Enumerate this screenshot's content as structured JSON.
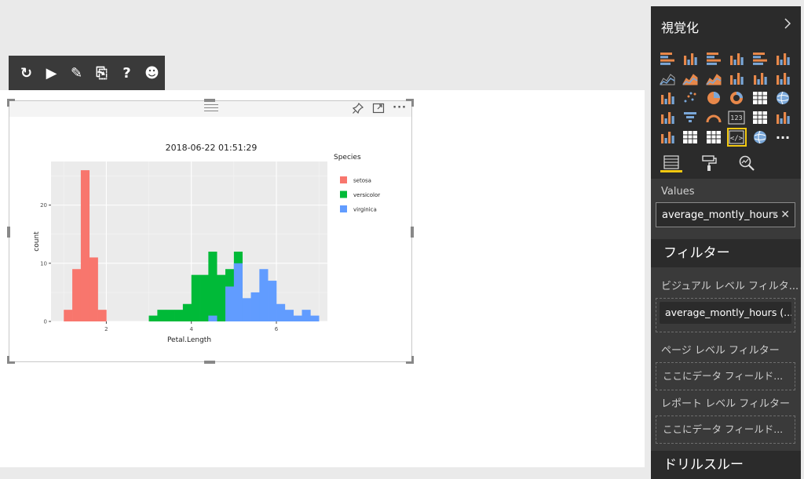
{
  "toolbar": {
    "items": [
      {
        "name": "refresh-icon",
        "glyph": "↻"
      },
      {
        "name": "run-icon",
        "glyph": "▶"
      },
      {
        "name": "edit-script-icon",
        "glyph": "✎"
      },
      {
        "name": "export-icon",
        "glyph": "⎘"
      },
      {
        "name": "help-icon",
        "glyph": "?"
      },
      {
        "name": "feedback-smile-icon",
        "glyph": "☻"
      }
    ]
  },
  "visual_header": {
    "pin_icon": "pin-icon",
    "focus_icon": "focus-mode-icon",
    "more_label": "···"
  },
  "colors": {
    "setosa": "#F8766D",
    "versicolor": "#00BA38",
    "virginica": "#619CFF",
    "accent": "#f2c811"
  },
  "chart_data": {
    "type": "bar",
    "title": "2018-06-22 01:51:29",
    "xlabel": "Petal.Length",
    "ylabel": "count",
    "legend_title": "Species",
    "legend_position": "right",
    "grid": true,
    "xlim": [
      0.7,
      7.2
    ],
    "ylim": [
      0,
      27.5
    ],
    "x_ticks": [
      "2",
      "4",
      "6"
    ],
    "x_tick_values": [
      2,
      4,
      6
    ],
    "y_ticks": [
      "0",
      "10",
      "20"
    ],
    "y_tick_values": [
      0,
      10,
      20
    ],
    "bin_width": 0.2,
    "series": [
      {
        "name": "setosa",
        "bins": [
          [
            1.0,
            2
          ],
          [
            1.2,
            9
          ],
          [
            1.4,
            26
          ],
          [
            1.6,
            11
          ],
          [
            1.8,
            2
          ]
        ]
      },
      {
        "name": "versicolor",
        "bins": [
          [
            3.0,
            1
          ],
          [
            3.2,
            2
          ],
          [
            3.4,
            2
          ],
          [
            3.6,
            2
          ],
          [
            3.8,
            3
          ],
          [
            4.0,
            8
          ],
          [
            4.2,
            8
          ],
          [
            4.4,
            12
          ],
          [
            4.6,
            8
          ],
          [
            4.8,
            9
          ],
          [
            5.0,
            12
          ]
        ]
      },
      {
        "name": "virginica",
        "bins": [
          [
            4.4,
            1
          ],
          [
            4.8,
            6
          ],
          [
            5.0,
            10
          ],
          [
            5.2,
            4
          ],
          [
            5.4,
            5
          ],
          [
            5.6,
            9
          ],
          [
            5.8,
            7
          ],
          [
            6.0,
            3
          ],
          [
            6.2,
            2
          ],
          [
            6.4,
            1
          ],
          [
            6.6,
            2
          ],
          [
            6.8,
            1
          ]
        ]
      }
    ]
  },
  "pane": {
    "title": "視覚化",
    "values_label": "Values",
    "values_field": "average_montly_hours",
    "filters_header": "フィルター",
    "visual_level_label": "ビジュアル レベル フィルタ...",
    "visual_level_field": "average_montly_hours (...",
    "page_level_label": "ページ レベル フィルター",
    "page_drop": "ここにデータ フィールド...",
    "report_level_label": "レポート レベル フィルター",
    "report_drop": "ここにデータ フィールド...",
    "drillthrough_header": "ドリルスルー"
  }
}
